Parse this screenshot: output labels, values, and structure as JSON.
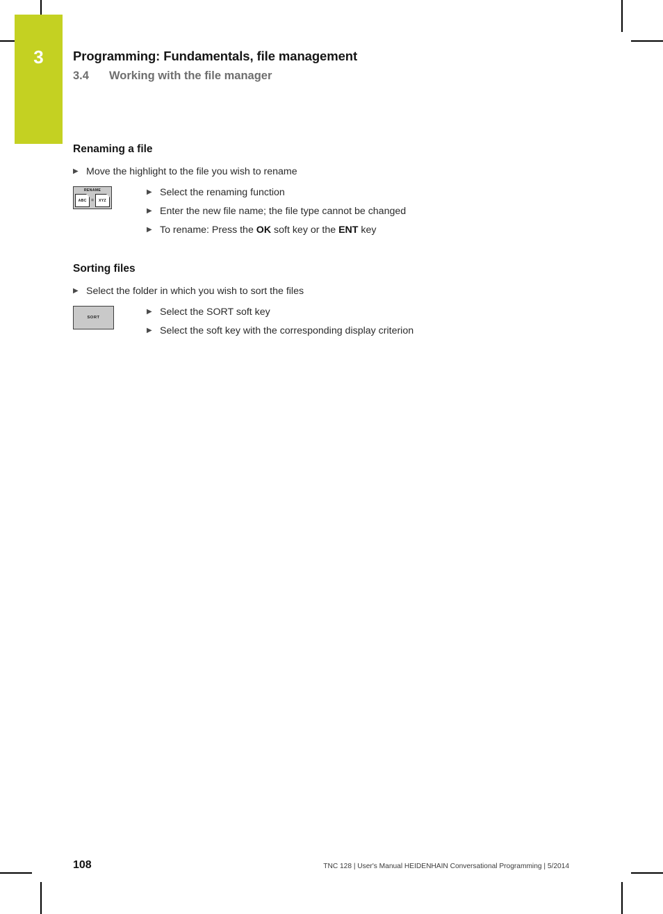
{
  "page": {
    "chapter_number": "3",
    "chapter_title": "Programming: Fundamentals, file management",
    "section_number": "3.4",
    "section_title": "Working with the file manager",
    "page_number": "108",
    "footer_reference": "TNC 128 | User's Manual HEIDENHAIN Conversational Programming | 5/2014",
    "accent_color": "#c4d122"
  },
  "sections": [
    {
      "heading": "Renaming a file",
      "lead_step": "Move the highlight to the file you wish to rename",
      "softkey": {
        "name": "rename-softkey",
        "caption": "RENAME",
        "left_doc_label": "ABC",
        "separator": "=",
        "right_doc_label": "XYZ"
      },
      "substeps": [
        {
          "parts": [
            {
              "text": "Select the renaming function",
              "bold": false
            }
          ]
        },
        {
          "parts": [
            {
              "text": "Enter the new file name; the file type cannot be changed",
              "bold": false
            }
          ]
        },
        {
          "parts": [
            {
              "text": "To rename: Press the ",
              "bold": false
            },
            {
              "text": "OK",
              "bold": true
            },
            {
              "text": " soft key or the ",
              "bold": false
            },
            {
              "text": "ENT",
              "bold": true
            },
            {
              "text": " key",
              "bold": false
            }
          ]
        }
      ]
    },
    {
      "heading": "Sorting files",
      "lead_step": "Select the folder in which you wish to sort the files",
      "softkey": {
        "name": "sort-softkey",
        "caption": "SORT"
      },
      "substeps": [
        {
          "parts": [
            {
              "text": "Select the SORT soft key",
              "bold": false
            }
          ]
        },
        {
          "parts": [
            {
              "text": "Select the soft key with the corresponding display criterion",
              "bold": false
            }
          ]
        }
      ]
    }
  ],
  "glyphs": {
    "bullet": "▶"
  }
}
